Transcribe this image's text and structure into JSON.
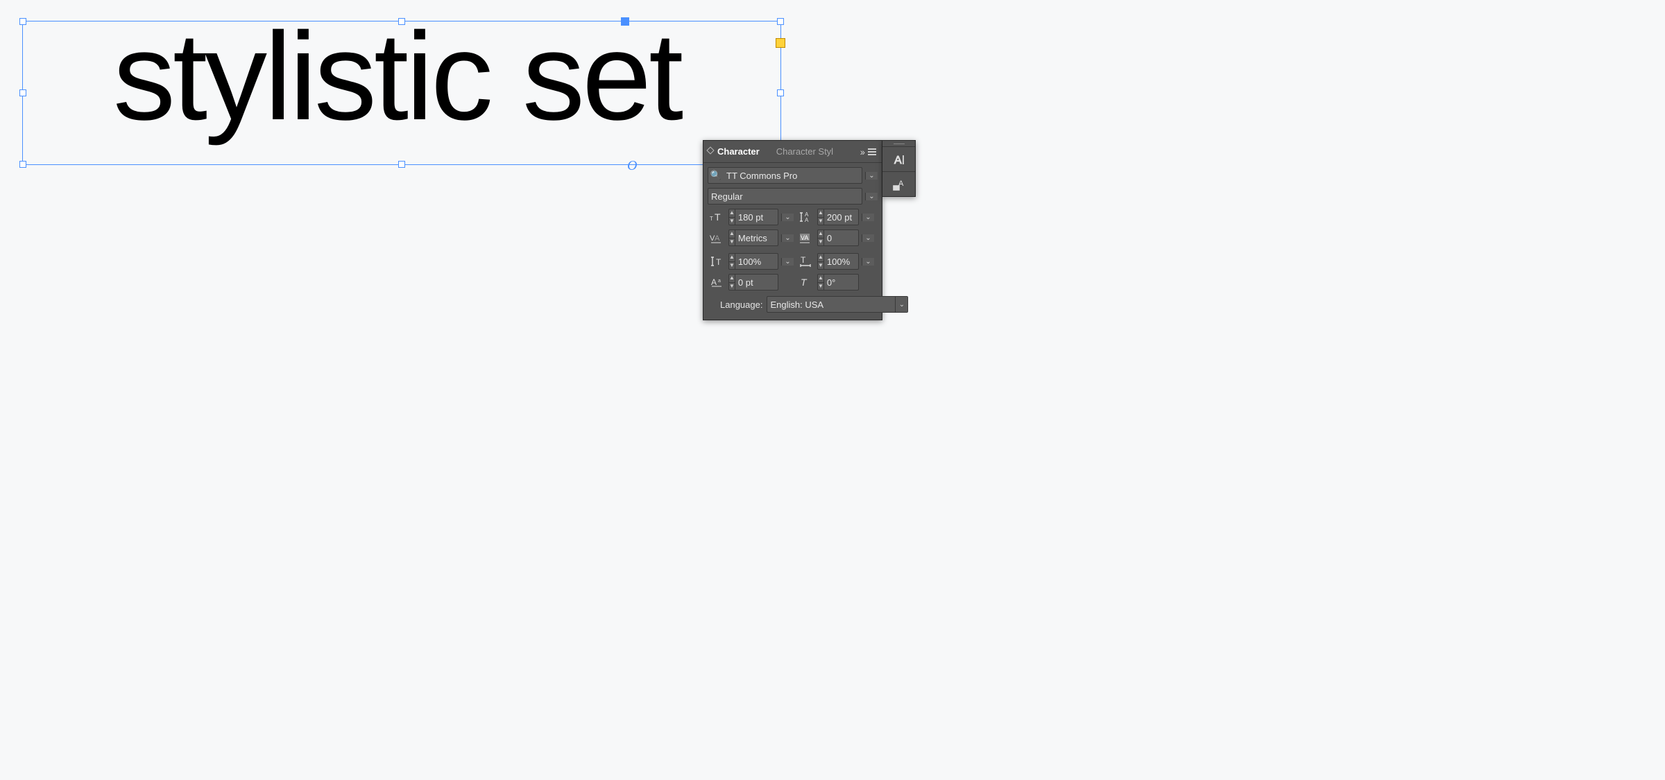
{
  "canvas": {
    "text": "stylistic set",
    "origin_marker": "O"
  },
  "panel": {
    "tabs": {
      "character": "Character",
      "charstyle": "Character Styl"
    },
    "font_family": "TT Commons Pro",
    "font_style": "Regular",
    "size": "180 pt",
    "leading": "200 pt",
    "kerning": "Metrics",
    "tracking": "0",
    "vscale": "100%",
    "hscale": "100%",
    "baseline": "0 pt",
    "skew": "0°",
    "language_label": "Language:",
    "language_value": "English: USA"
  }
}
